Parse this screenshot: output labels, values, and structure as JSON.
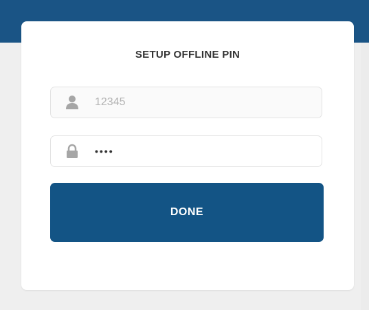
{
  "dialog": {
    "title": "SETUP OFFLINE PIN"
  },
  "fields": {
    "username": {
      "icon": "user-icon",
      "placeholder": "12345"
    },
    "pin": {
      "icon": "lock-icon",
      "value_masked": "••••"
    }
  },
  "actions": {
    "done_label": "DONE"
  },
  "colors": {
    "brand": "#1a5485",
    "button": "#135485",
    "icon_gray": "#a6a6a6"
  }
}
